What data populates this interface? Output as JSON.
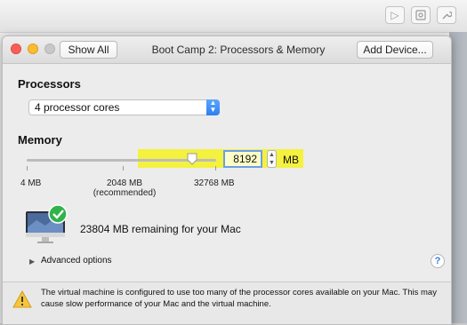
{
  "background_window": {
    "toolbar_icons": [
      "play-icon",
      "settings-icon",
      "wrench-icon"
    ]
  },
  "dialog": {
    "title": "Boot Camp 2: Processors & Memory",
    "show_all_label": "Show All",
    "add_device_label": "Add Device..."
  },
  "processors": {
    "heading": "Processors",
    "selected": "4 processor cores"
  },
  "memory": {
    "heading": "Memory",
    "value": "8192",
    "value_mb": 8192,
    "unit": "MB",
    "scale": {
      "min_label": "4 MB",
      "recommended_label_line1": "2048 MB",
      "recommended_label_line2": "(recommended)",
      "max_label": "32768 MB"
    }
  },
  "remaining": {
    "text": "23804 MB remaining for your Mac"
  },
  "advanced": {
    "label": "Advanced options"
  },
  "help": {
    "label": "?"
  },
  "warning": {
    "text": "The virtual machine is configured to use too many of the processor cores available on your Mac. This may cause slow performance of your Mac and the virtual machine."
  },
  "colors": {
    "highlight": "#f4f13f",
    "accent": "#2f7ff0",
    "check": "#2fb34a"
  }
}
